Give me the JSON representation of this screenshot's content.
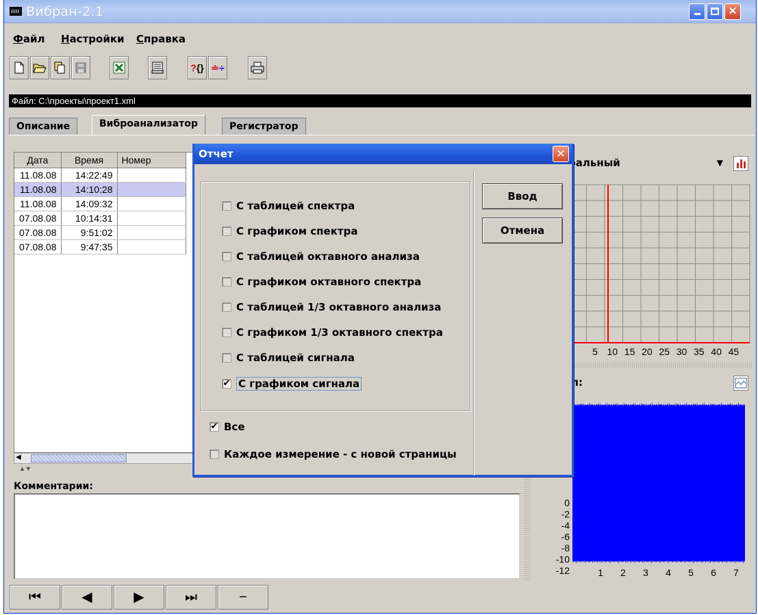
{
  "window": {
    "title": "Вибран-2.1"
  },
  "menu": {
    "items": [
      "Файл",
      "Настройки",
      "Справка"
    ]
  },
  "toolbar": {
    "buttons": [
      "new-icon",
      "open-icon",
      "import-icon",
      "save-icon",
      "excel-icon",
      "print-preview-icon",
      "help-icon",
      "settings-icon",
      "print-icon"
    ]
  },
  "path": {
    "text": "Файл: C:\\проекты\\проект1.xml"
  },
  "tabs": [
    "Описание",
    "Виброанализатор",
    "Регистратор"
  ],
  "table": {
    "headers": [
      "Дата",
      "Время",
      "Номер"
    ],
    "rows": [
      [
        "11.08.08",
        "14:22:49",
        ""
      ],
      [
        "11.08.08",
        "14:10:28",
        ""
      ],
      [
        "11.08.08",
        "14:09:32",
        ""
      ],
      [
        "07.08.08",
        "10:14:31",
        ""
      ],
      [
        "07.08.08",
        "9:51:02",
        ""
      ],
      [
        "07.08.08",
        "9:47:35",
        ""
      ]
    ],
    "selected_row": 1
  },
  "comments": {
    "label": "Комментарии:",
    "value": ""
  },
  "spectrum": {
    "combo_value": "ральный",
    "x_ticks": [
      "5",
      "10",
      "15",
      "20",
      "25",
      "30",
      "35",
      "40",
      "45"
    ]
  },
  "signal": {
    "label": "л:",
    "y_ticks": [
      "0",
      "-2",
      "-4",
      "-6",
      "-8",
      "-10",
      "-12"
    ],
    "x_ticks": [
      "1",
      "2",
      "3",
      "4",
      "5",
      "6",
      "7"
    ]
  },
  "nav": {
    "buttons": [
      "first-icon",
      "prev-icon",
      "next-icon",
      "last-icon",
      "minus-icon"
    ]
  },
  "dialog": {
    "title": "Отчет",
    "options": [
      {
        "label": "С таблицей спектра",
        "checked": false
      },
      {
        "label": "С графиком спектра",
        "checked": false
      },
      {
        "label": "С таблицей октавного анализа",
        "checked": false
      },
      {
        "label": "С графиком октавного спектра",
        "checked": false
      },
      {
        "label": "С таблицей 1/3 октавного анализа",
        "checked": false
      },
      {
        "label": "С графиком 1/3 октавного спектра",
        "checked": false
      },
      {
        "label": "С таблицей сигнала",
        "checked": false
      },
      {
        "label": "С графиком сигнала",
        "checked": true
      }
    ],
    "all_label": "Все",
    "all_checked": true,
    "each_new_page_label": "Каждое измерение - с новой страницы",
    "each_new_page_checked": false,
    "ok_label": "Ввод",
    "cancel_label": "Отмена"
  },
  "colors": {
    "title_bar": "#2a5ad6",
    "signal_fill": "#0000ff",
    "marker": "#ff0000"
  }
}
